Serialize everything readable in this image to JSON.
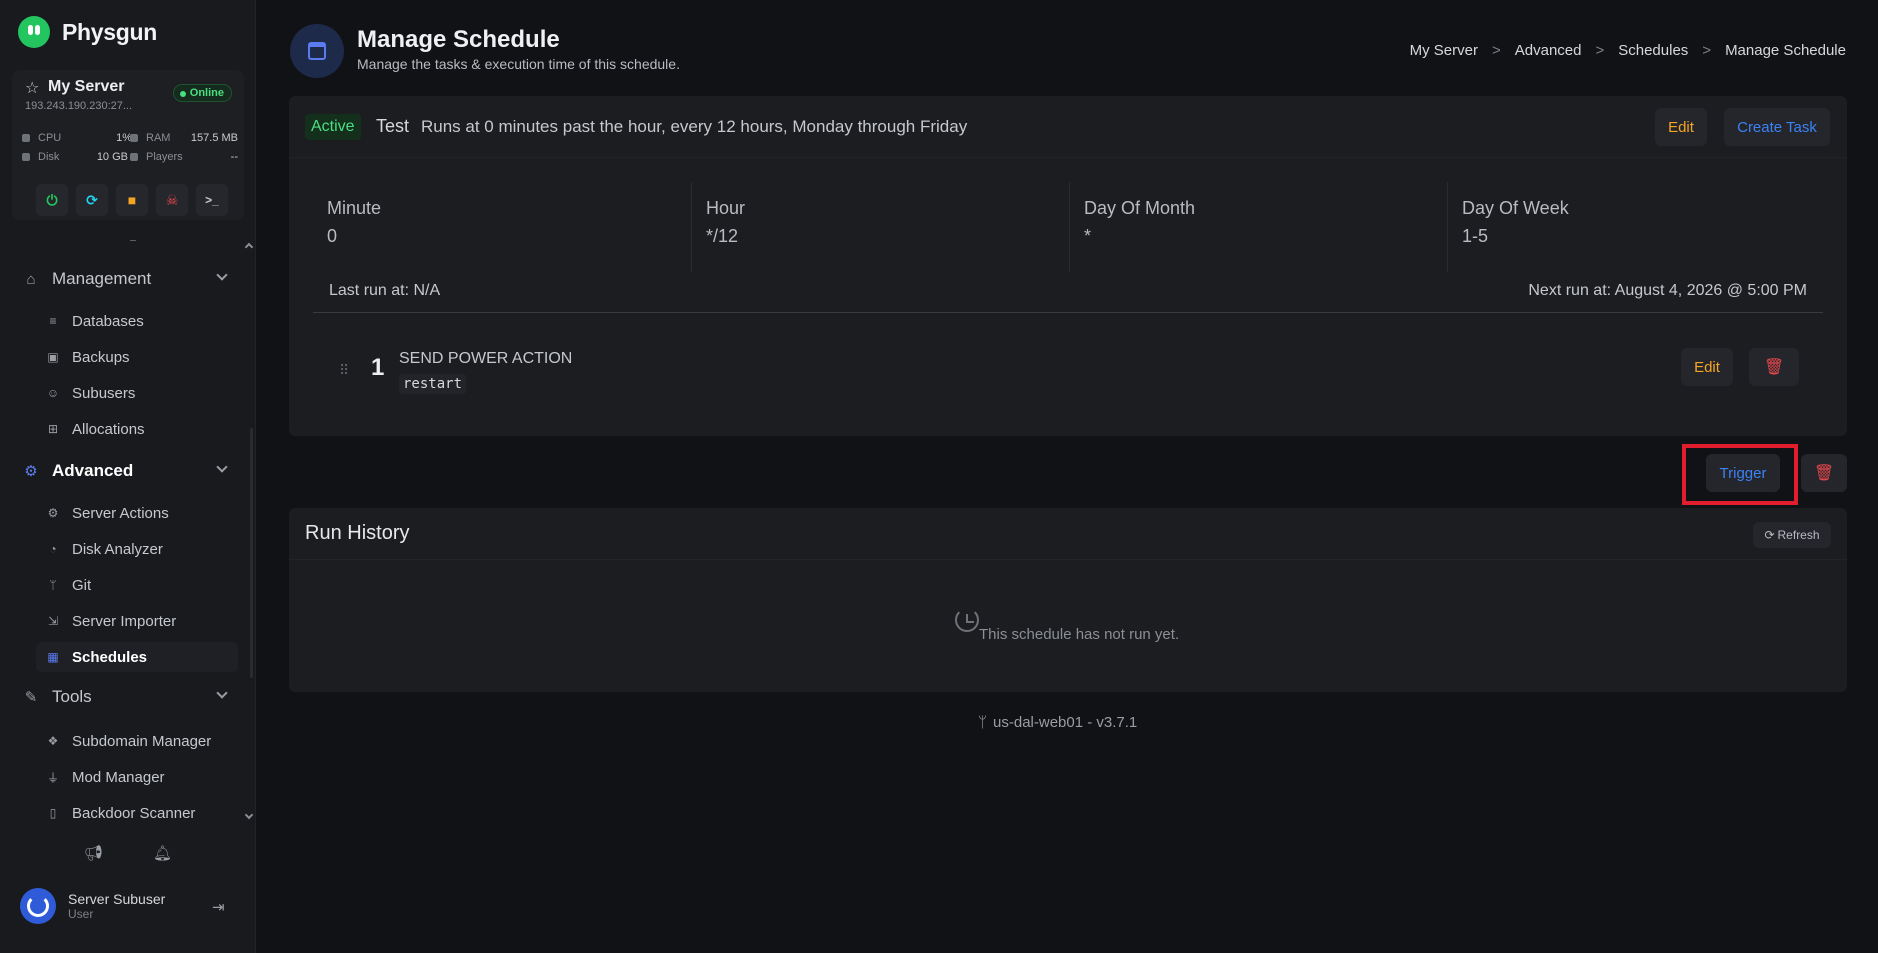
{
  "app": {
    "name": "Physgun"
  },
  "server": {
    "name": "My Server",
    "status": "Online",
    "ip": "193.243.190.230:27...",
    "stats": {
      "cpu_label": "CPU",
      "cpu_value": "1%",
      "ram_label": "RAM",
      "ram_value": "157.5 MB",
      "disk_label": "Disk",
      "disk_value": "10 GB",
      "players_label": "Players",
      "players_value": "--"
    }
  },
  "power": {
    "start": "⏻",
    "restart": "⟳",
    "stop": "■",
    "kill": "☠",
    "console": ">_"
  },
  "nav": {
    "management": {
      "label": "Management",
      "items": [
        {
          "label": "Databases"
        },
        {
          "label": "Backups"
        },
        {
          "label": "Subusers"
        },
        {
          "label": "Allocations"
        }
      ]
    },
    "advanced": {
      "label": "Advanced",
      "items": [
        {
          "label": "Server Actions"
        },
        {
          "label": "Disk Analyzer"
        },
        {
          "label": "Git"
        },
        {
          "label": "Server Importer"
        },
        {
          "label": "Schedules"
        }
      ]
    },
    "tools": {
      "label": "Tools",
      "items": [
        {
          "label": "Subdomain Manager"
        },
        {
          "label": "Mod Manager"
        },
        {
          "label": "Backdoor Scanner"
        }
      ]
    }
  },
  "user": {
    "name": "Server Subuser",
    "role": "User"
  },
  "page": {
    "title": "Manage Schedule",
    "subtitle": "Manage the tasks & execution time of this schedule.",
    "breadcrumbs": [
      "My Server",
      "Advanced",
      "Schedules",
      "Manage Schedule"
    ],
    "separator": ">"
  },
  "schedule": {
    "status": "Active",
    "name": "Test",
    "description": "Runs at 0 minutes past the hour, every 12 hours, Monday through Friday",
    "edit_label": "Edit",
    "create_task_label": "Create Task",
    "cron": [
      {
        "label": "Minute",
        "value": "0"
      },
      {
        "label": "Hour",
        "value": "*/12"
      },
      {
        "label": "Day Of Month",
        "value": "*"
      },
      {
        "label": "Day Of Week",
        "value": "1-5"
      }
    ],
    "last_run": "Last run at: N/A",
    "next_run": "Next run at: August 4, 2026 @ 5:00 PM",
    "tasks": [
      {
        "number": "1",
        "action": "SEND POWER ACTION",
        "argument": "restart",
        "edit_label": "Edit"
      }
    ],
    "trigger_label": "Trigger"
  },
  "history": {
    "title": "Run History",
    "refresh_label": "Refresh",
    "empty_text": "This schedule has not run yet."
  },
  "footer": {
    "version": "us-dal-web01 - v3.7.1"
  },
  "colors": {
    "accent": "#5b7cf0",
    "success": "#4ade80",
    "warning": "#f5a524",
    "danger": "#e5484d",
    "link": "#3b82f6"
  }
}
